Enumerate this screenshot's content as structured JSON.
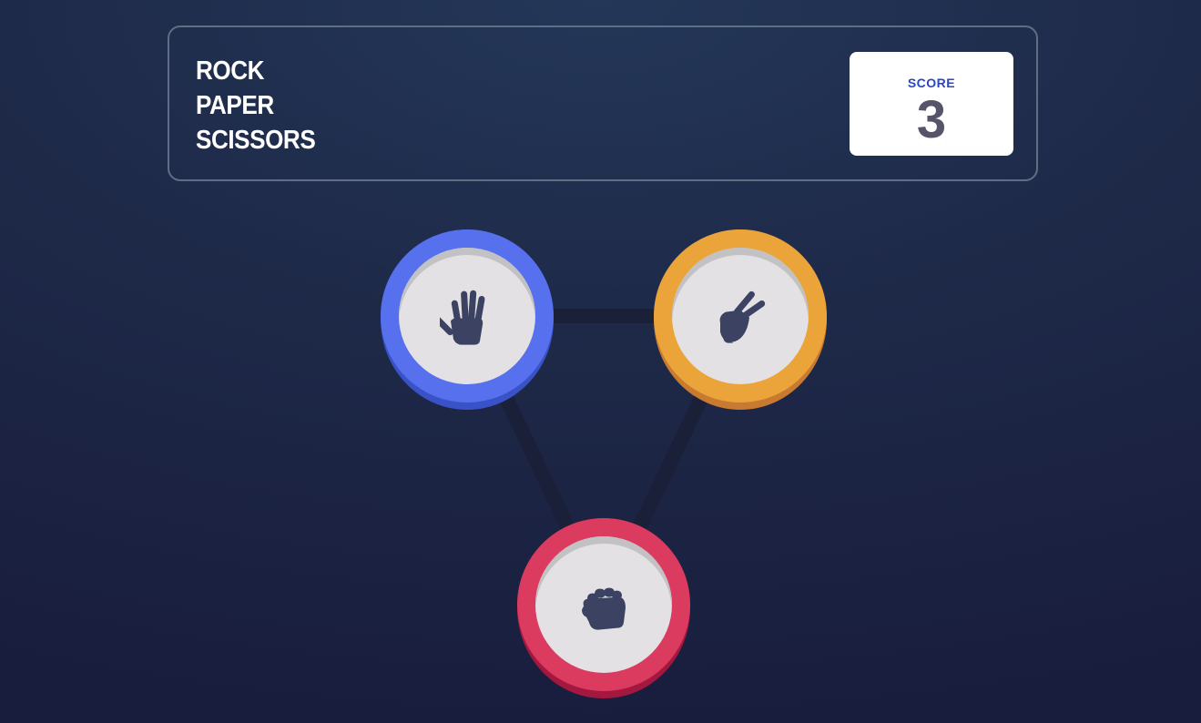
{
  "game": {
    "title_lines": [
      "ROCK",
      "PAPER",
      "SCISSORS"
    ],
    "score_label": "SCORE",
    "score_value": "3"
  },
  "choices": [
    {
      "id": "paper",
      "icon": "paper-hand-icon",
      "color": "#5670ee"
    },
    {
      "id": "scissors",
      "icon": "scissors-hand-icon",
      "color": "#eaa43a"
    },
    {
      "id": "rock",
      "icon": "rock-fist-icon",
      "color": "#dc3b60"
    }
  ],
  "colors": {
    "background": "#1f2a4a",
    "header_border": "#606e85",
    "score_label": "#2a46c0",
    "score_value": "#565468",
    "connector_line": "#1b2039",
    "icon": "#3b4262"
  }
}
